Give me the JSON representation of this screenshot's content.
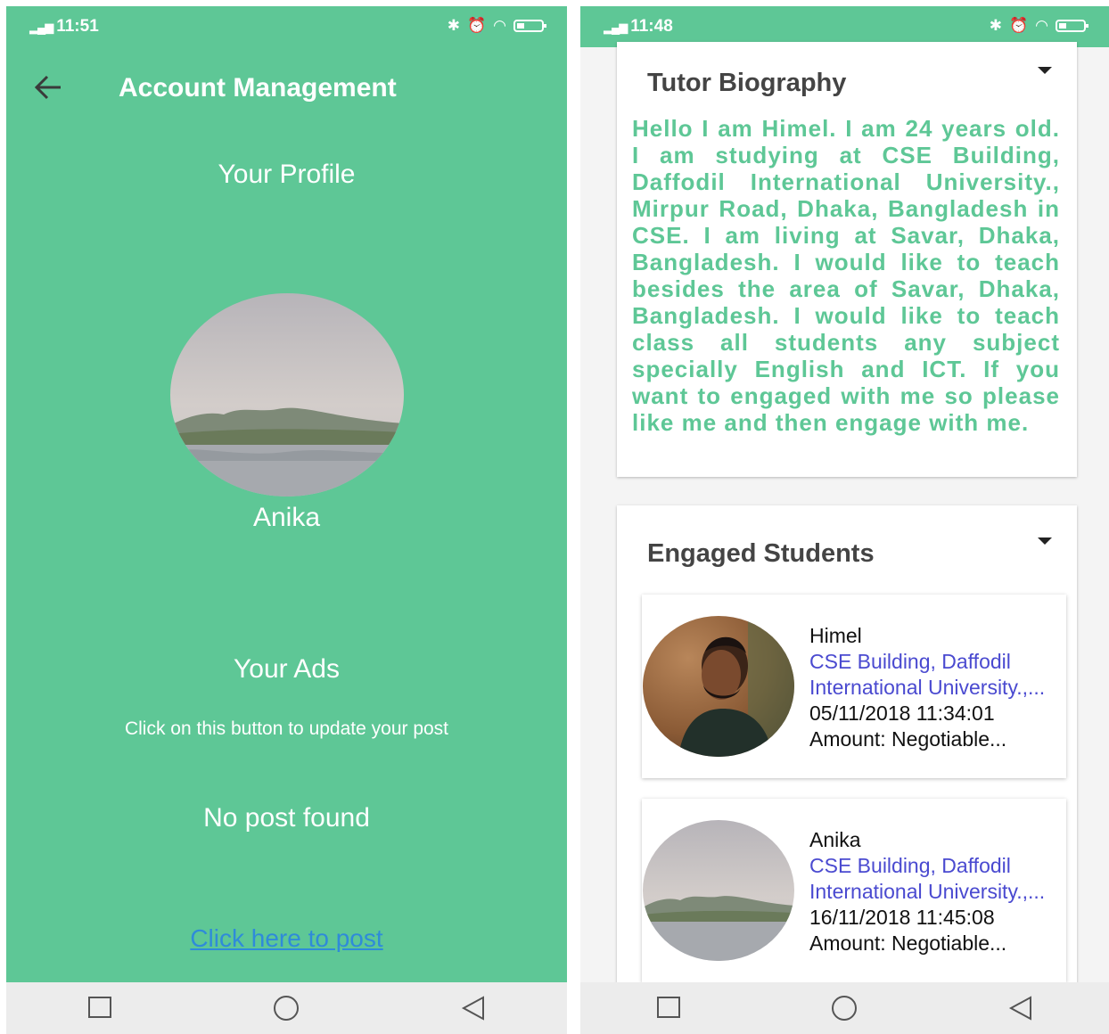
{
  "left_screen": {
    "status": {
      "time": "11:51"
    },
    "toolbar": {
      "title": "Account Management"
    },
    "profile": {
      "heading": "Your Profile",
      "name": "Anika"
    },
    "ads": {
      "heading": "Your Ads",
      "hint": "Click on this button to update your post",
      "empty": "No post found",
      "post_link": "Click here to post"
    },
    "icons": {
      "back": "back-arrow-icon"
    }
  },
  "right_screen": {
    "status": {
      "time": "11:48"
    },
    "biography": {
      "title": "Tutor Biography",
      "text": "Hello I am Himel. I am 24 years old. I am studying at CSE Building, Daffodil International University., Mirpur Road, Dhaka, Bangladesh in CSE. I am living at Savar, Dhaka, Bangladesh. I would like to teach besides the area of Savar, Dhaka, Bangladesh. I would like to teach class all students any subject specially English and ICT. If you want to engaged with me so please like me and then engage with me."
    },
    "engaged": {
      "title": "Engaged Students",
      "students": [
        {
          "name": "Himel",
          "address_line1": "CSE Building, Daffodil",
          "address_line2": "International University.,...",
          "date": "05/11/2018 11:34:01",
          "amount": "Amount: Negotiable..."
        },
        {
          "name": "Anika",
          "address_line1": "CSE Building, Daffodil",
          "address_line2": "International University.,...",
          "date": "16/11/2018 11:45:08",
          "amount": "Amount: Negotiable..."
        }
      ]
    }
  },
  "colors": {
    "primary": "#5ec796",
    "link": "#2f8bd9",
    "address": "#4a4ad0",
    "card_title": "#444444",
    "nav_bar": "#ececec"
  }
}
